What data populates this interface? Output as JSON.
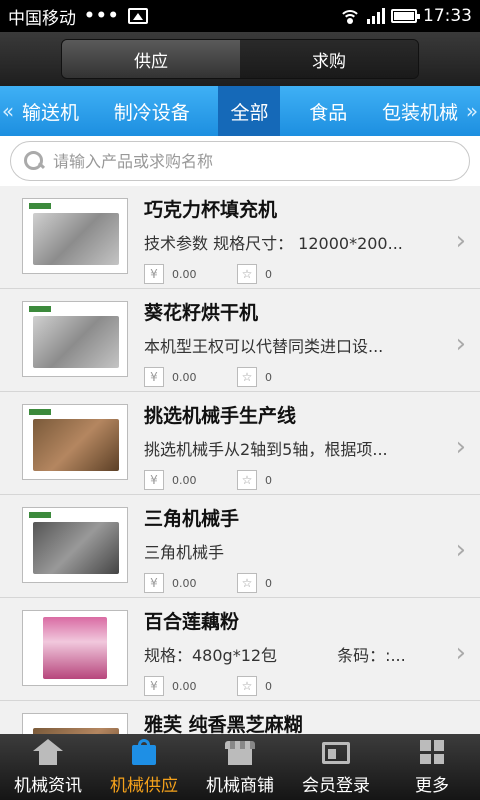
{
  "status_bar": {
    "carrier": "中国移动",
    "dots": "•••",
    "time": "17:33"
  },
  "header": {
    "tabs": [
      {
        "label": "供应"
      },
      {
        "label": "求购"
      }
    ]
  },
  "category_nav": {
    "prev_arrow": "«",
    "next_arrow": "»",
    "items": [
      {
        "label": "输送机"
      },
      {
        "label": "制冷设备"
      },
      {
        "label": "全部"
      },
      {
        "label": "食品"
      },
      {
        "label": "包装机械"
      }
    ]
  },
  "search": {
    "placeholder": "请输入产品或求购名称",
    "value": ""
  },
  "products": [
    {
      "title": "巧克力杯填充机",
      "desc": "技术参数 规格尺寸： 12000*200...",
      "price": "0.00",
      "favorites": "0"
    },
    {
      "title": "葵花籽烘干机",
      "desc": "本机型王权可以代替同类进口设...",
      "price": "0.00",
      "favorites": "0"
    },
    {
      "title": "挑选机械手生产线",
      "desc": "挑选机械手从2轴到5轴，根据项...",
      "price": "0.00",
      "favorites": "0"
    },
    {
      "title": "三角机械手",
      "desc": "三角机械手",
      "price": "0.00",
      "favorites": "0"
    },
    {
      "title": "百合莲藕粉",
      "desc": "规格：480g*12包",
      "desc_extra": "条码：:...",
      "price": "0.00",
      "favorites": "0"
    },
    {
      "title": "雅芙 纯香黑芝麻糊",
      "desc": "",
      "price": "",
      "favorites": ""
    }
  ],
  "tab_bar": {
    "items": [
      {
        "label": "机械资讯"
      },
      {
        "label": "机械供应"
      },
      {
        "label": "机械商铺"
      },
      {
        "label": "会员登录"
      },
      {
        "label": "更多"
      }
    ]
  },
  "colors": {
    "accent_blue": "#1d8fe0",
    "active_tab": "#f4a11b",
    "header_dark": "#2a2a2a"
  },
  "icons": {
    "price": "yen-icon",
    "favorite": "star-icon",
    "chevron": "chevron-right-icon"
  }
}
